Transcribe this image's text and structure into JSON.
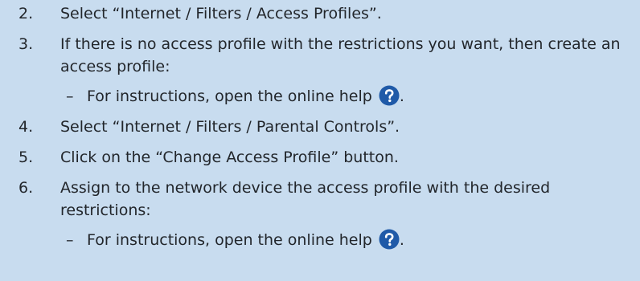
{
  "steps": [
    {
      "number": "2.",
      "text": "Select “Internet / Filters / Access Profiles”."
    },
    {
      "number": "3.",
      "text": "If there is no access profile with the restrictions you want, then create an access profile:",
      "sub": {
        "dash": "–",
        "text": "For instructions, open the online help",
        "trailing": "."
      }
    },
    {
      "number": "4.",
      "text": "Select “Internet / Filters / Parental Controls”."
    },
    {
      "number": "5.",
      "text": "Click on the “Change Access Profile” button."
    },
    {
      "number": "6.",
      "text": "Assign to the network device the access profile with the desired restrictions:",
      "sub": {
        "dash": "–",
        "text": "For instructions, open the online help",
        "trailing": "."
      }
    }
  ],
  "colors": {
    "background": "#c8dcef",
    "text": "#22262b",
    "help_icon": "#1f5aa8"
  },
  "icons": {
    "help": "question-circle-icon"
  }
}
